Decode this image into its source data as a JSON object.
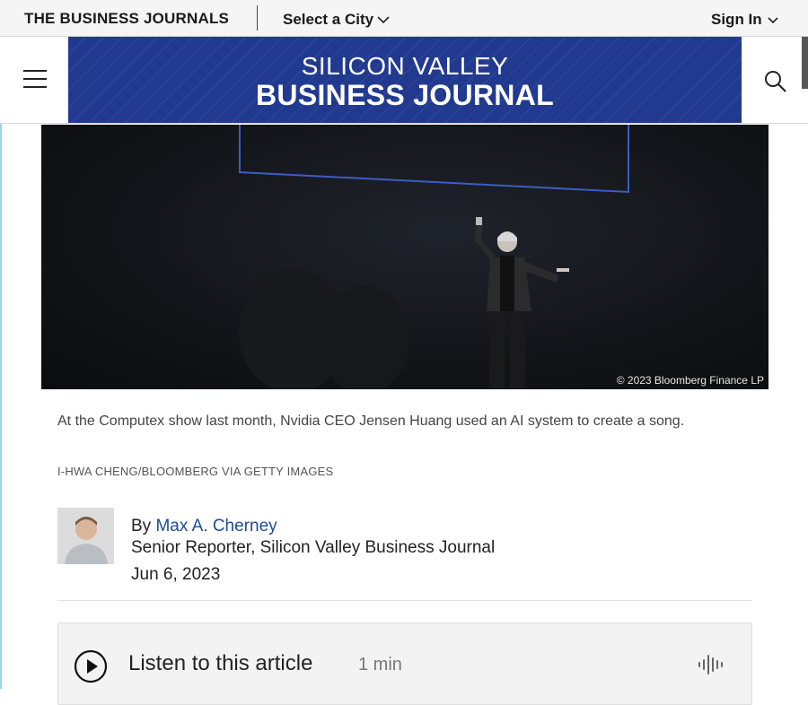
{
  "topbar": {
    "brand": "THE BUSINESS JOURNALS",
    "city_label": "Select a City",
    "signin_label": "Sign In"
  },
  "header": {
    "masthead_line1": "SILICON VALLEY",
    "masthead_line2": "BUSINESS JOURNAL",
    "brand_color": "#213a8f"
  },
  "hero": {
    "overlay_credit": "© 2023 Bloomberg Finance LP",
    "caption": "At the Computex show last month, Nvidia CEO Jensen Huang used an AI system to create a song.",
    "photo_credit": "I-HWA CHENG/BLOOMBERG VIA GETTY IMAGES"
  },
  "byline": {
    "prefix": "By",
    "author": "Max A. Cherney",
    "role": "Senior Reporter, Silicon Valley Business Journal",
    "date": "Jun 6, 2023",
    "link_color": "#1d4a9a"
  },
  "audio": {
    "label": "Listen to this article",
    "duration": "1 min"
  },
  "icons": {
    "menu": "hamburger-icon",
    "search": "search-icon",
    "city_dropdown": "chevron-down-icon",
    "signin_dropdown": "chevron-down-icon",
    "play": "play-icon",
    "waveform": "waveform-icon"
  }
}
